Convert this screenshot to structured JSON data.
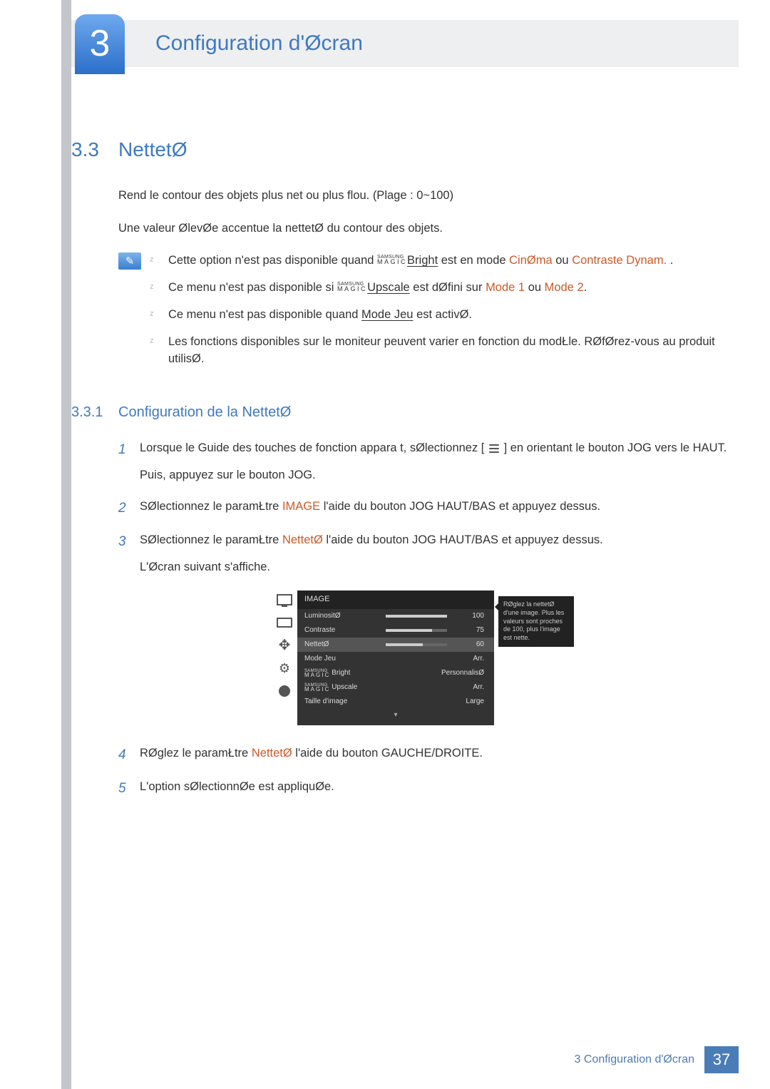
{
  "chapter": {
    "number": "3",
    "title": "Configuration d'Øcran"
  },
  "section": {
    "number": "3.3",
    "title": "NettetØ"
  },
  "intro": {
    "p1": "Rend le contour des objets plus net ou plus flou. (Plage : 0~100)",
    "p2": "Une valeur ØlevØe accentue la nettetØ du contour des objets."
  },
  "magic": {
    "sup": "SAMSUNG",
    "mid": "MAGIC"
  },
  "notes": [
    {
      "pre": "Cette option n'est pas disponible quand ",
      "suffix_label": "Bright",
      "mid": " est en mode ",
      "hl1": "CinØma",
      "sep": " ou ",
      "hl2": "Contraste Dynam.",
      "tail": " ."
    },
    {
      "pre": "Ce menu n'est pas disponible si ",
      "suffix_label": "Upscale",
      "mid": " est dØfini sur ",
      "hl1": "Mode 1",
      "sep": " ou ",
      "hl2": "Mode 2",
      "tail": "."
    },
    {
      "pre": "Ce menu n'est pas disponible quand ",
      "link": "Mode Jeu",
      "tail": " est activØ."
    },
    {
      "text": "Les fonctions disponibles sur le moniteur peuvent varier en fonction du modŁle. RØfØrez-vous au produit utilisØ."
    }
  ],
  "subsection": {
    "number": "3.3.1",
    "title": "Configuration de la NettetØ"
  },
  "steps": [
    {
      "num": "1",
      "p1a": "Lorsque le Guide des touches de fonction appara t, sØlectionnez [",
      "p1b": "] en orientant le bouton JOG vers le HAUT.",
      "p2": "Puis, appuyez sur le bouton JOG."
    },
    {
      "num": "2",
      "pre": "SØlectionnez le paramŁtre ",
      "hl": "IMAGE",
      "post": "   l'aide du bouton JOG HAUT/BAS et appuyez dessus."
    },
    {
      "num": "3",
      "pre": "SØlectionnez le paramŁtre ",
      "hl": "NettetØ",
      "post": "   l'aide du bouton JOG HAUT/BAS et appuyez dessus.",
      "p2": "L'Øcran suivant s'affiche."
    },
    {
      "num": "4",
      "pre": "RØglez le paramŁtre ",
      "hl": "NettetØ",
      "post": "   l'aide du bouton GAUCHE/DROITE."
    },
    {
      "num": "5",
      "text": "L'option sØlectionnØe est appliquØe."
    }
  ],
  "osd": {
    "title": "IMAGE",
    "tooltip": "RØglez la nettetØ d'une image. Plus les valeurs sont proches de 100, plus l'image est nette.",
    "rows": [
      {
        "label": "LuminositØ",
        "type": "bar",
        "value": 100,
        "fill": 100
      },
      {
        "label": "Contraste",
        "type": "bar",
        "value": 75,
        "fill": 75
      },
      {
        "label": "NettetØ",
        "type": "bar",
        "value": 60,
        "fill": 60,
        "selected": true
      },
      {
        "label": "Mode Jeu",
        "type": "text",
        "value": "Arr."
      },
      {
        "label_magic": true,
        "suffix": "Bright",
        "type": "text",
        "value": "PersonnalisØ"
      },
      {
        "label_magic": true,
        "suffix": "Upscale",
        "type": "text",
        "value": "Arr."
      },
      {
        "label": "Taille d'image",
        "type": "text",
        "value": "Large"
      }
    ]
  },
  "footer": {
    "text": "3 Configuration d'Øcran",
    "page": "37"
  }
}
